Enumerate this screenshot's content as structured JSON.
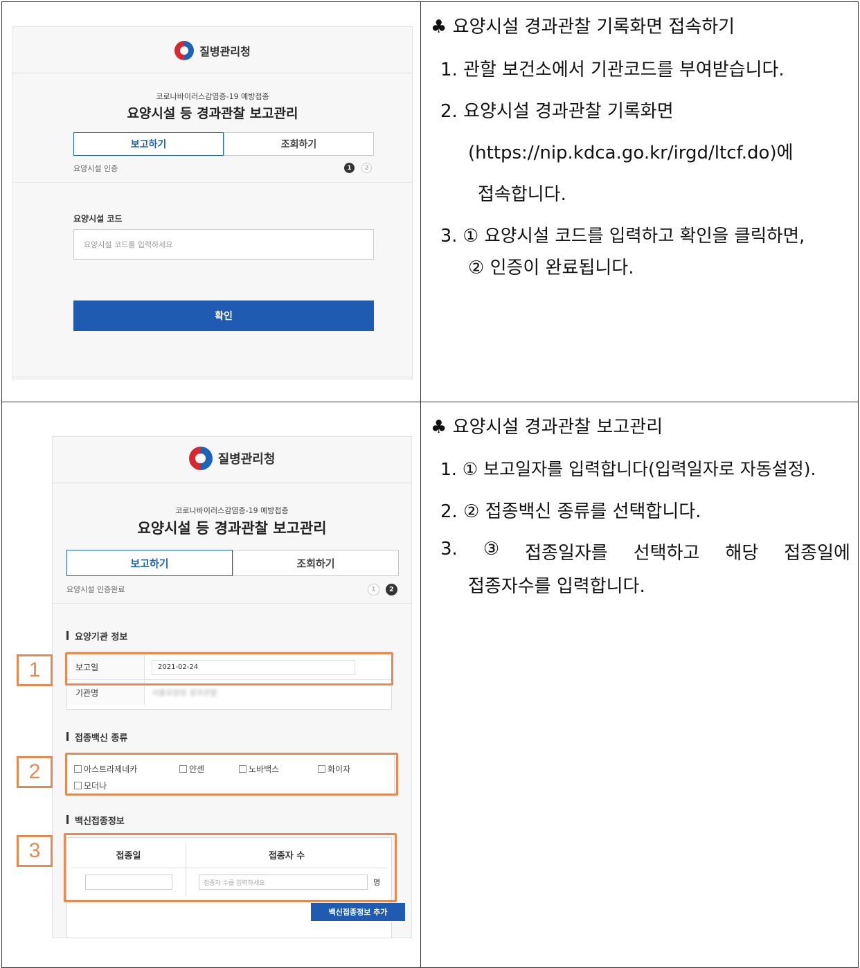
{
  "panel1": {
    "logo_text": "질병관리청",
    "subtitle": "코로나바이러스감염증-19 예방접종",
    "title": "요양시설 등 경과관찰 보고관리",
    "tabs": [
      "보고하기",
      "조회하기"
    ],
    "step_label": "요양시설 인증",
    "steps": [
      "1",
      "2"
    ],
    "code_label": "요양시설 코드",
    "code_placeholder": "요양시설 코드를 입력하세요",
    "confirm_button": "확인"
  },
  "panel2": {
    "logo_text": "질병관리청",
    "subtitle": "코로나바이러스감염증-19 예방접종",
    "title": "요양시설 등 경과관찰 보고관리",
    "tabs": [
      "보고하기",
      "조회하기"
    ],
    "step_label": "요양시설 인증완료",
    "steps": [
      "1",
      "2"
    ],
    "section_org": "요양기관 정보",
    "report_date_label": "보고일",
    "report_date_value": "2021-02-24",
    "org_name_label": "기관명",
    "org_name_value": "서울요양원 경과관찰",
    "section_vaccine": "접종백신 종류",
    "vaccines": [
      "아스트라제네카",
      "얀센",
      "노바백스",
      "화이자",
      "모더나"
    ],
    "section_info": "백신접종정보",
    "col_date": "접종일",
    "col_count": "접종자 수",
    "count_placeholder": "접종자 수를 입력하세요",
    "count_unit": "명",
    "add_button": "백신접종정보 추가",
    "markers": [
      "1",
      "2",
      "3"
    ]
  },
  "instructions1": {
    "header": "요양시설 경과관찰 기록화면 접속하기",
    "bullet": "♣",
    "item1": "1. 관할 보건소에서 기관코드를 부여받습니다.",
    "item2": "2. 요양시설 경과관찰 기록화면",
    "item2_url": "(https://nip.kdca.go.kr/irgd/ltcf.do)에",
    "item2_tail": "접속합니다.",
    "item3": "3. ① 요양시설 코드를 입력하고 확인을 클릭하면,",
    "item3_tail": "② 인증이 완료됩니다."
  },
  "instructions2": {
    "header": "요양시설 경과관찰 보고관리",
    "bullet": "♣",
    "item1": "1. ① 보고일자를 입력합니다(입력일자로 자동설정).",
    "item2": "2. ② 접종백신 종류를 선택합니다.",
    "item3_words": [
      "3.",
      "③",
      "접종일자를",
      "선택하고",
      "해당",
      "접종일에"
    ],
    "item3_tail": "접종자수를 입력합니다."
  }
}
